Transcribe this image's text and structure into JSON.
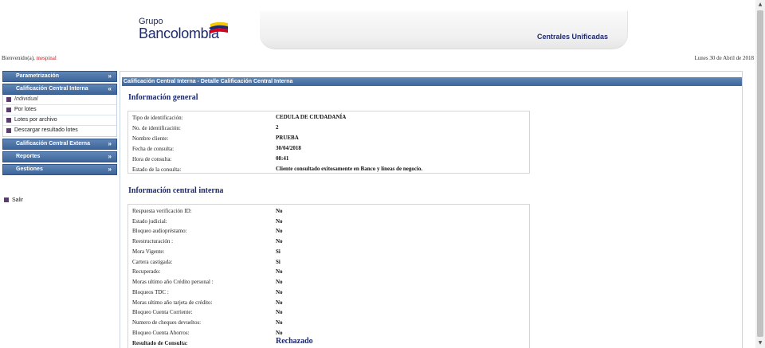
{
  "header": {
    "logo_line1": "Grupo",
    "logo_line2": "Bancolombia",
    "banner_title": "Centrales Unificadas"
  },
  "welcome": {
    "prefix": "Bienvenido(a), ",
    "user": "mespinal"
  },
  "date": "Lunes 30 de Abril de 2018",
  "sidebar": {
    "sections": [
      {
        "label": "Parametrización",
        "chevron": "»"
      },
      {
        "label": "Calificación Central Interna",
        "chevron": "«",
        "items": [
          "Individual",
          "Por lotes",
          "Lotes por archivo",
          "Descargar resultado lotes"
        ]
      },
      {
        "label": "Calificación Central Externa",
        "chevron": "»"
      },
      {
        "label": "Reportes",
        "chevron": "»"
      },
      {
        "label": "Gestiones",
        "chevron": "»"
      }
    ],
    "logout": "Salir"
  },
  "panel": {
    "breadcrumb": "Calificación Central Interna - Detalle Calificación Central Interna",
    "general": {
      "title": "Información general",
      "rows": [
        {
          "label": "Tipo de identificación:",
          "value": "CEDULA DE CIUDADANÍA"
        },
        {
          "label": "No. de identificación:",
          "value": "2"
        },
        {
          "label": "Nombre cliente:",
          "value": "PRUEBA"
        },
        {
          "label": "Fecha de consulta:",
          "value": "30/04/2018"
        },
        {
          "label": "Hora de consulta:",
          "value": "08:41"
        },
        {
          "label": "Estado de la consulta:",
          "value": "Cliente consultado exitosamente en Banco y líneas de negocio."
        }
      ]
    },
    "central": {
      "title": "Información central interna",
      "rows": [
        {
          "label": "Respuesta verificación ID:",
          "value": "No"
        },
        {
          "label": "Estado judicial:",
          "value": "No"
        },
        {
          "label": "Bloqueo audiopréstamo:",
          "value": "No"
        },
        {
          "label": "Reestructuración :",
          "value": "No"
        },
        {
          "label": "Mora Vigente:",
          "value": "Si"
        },
        {
          "label": "Cartera castigada:",
          "value": "Si"
        },
        {
          "label": "Recuperado:",
          "value": "No"
        },
        {
          "label": "Moras ultimo año Crédito personal :",
          "value": "No"
        },
        {
          "label": "Bloqueos TDC :",
          "value": "No"
        },
        {
          "label": "Moras ultimo año tarjeta de crédito:",
          "value": "No"
        },
        {
          "label": "Bloqueo Cuenta Corriente:",
          "value": "No"
        },
        {
          "label": "Numero de cheques devueltos:",
          "value": "No"
        },
        {
          "label": "Bloqueo Cuenta Ahorros:",
          "value": "No"
        }
      ],
      "result_label": "Resultado de Consulta:",
      "result_value": "Rechazado"
    }
  },
  "colors": {
    "brand_navy": "#1e2a6e",
    "menu_blue": "#3e659a",
    "user_red": "#cc1111"
  }
}
